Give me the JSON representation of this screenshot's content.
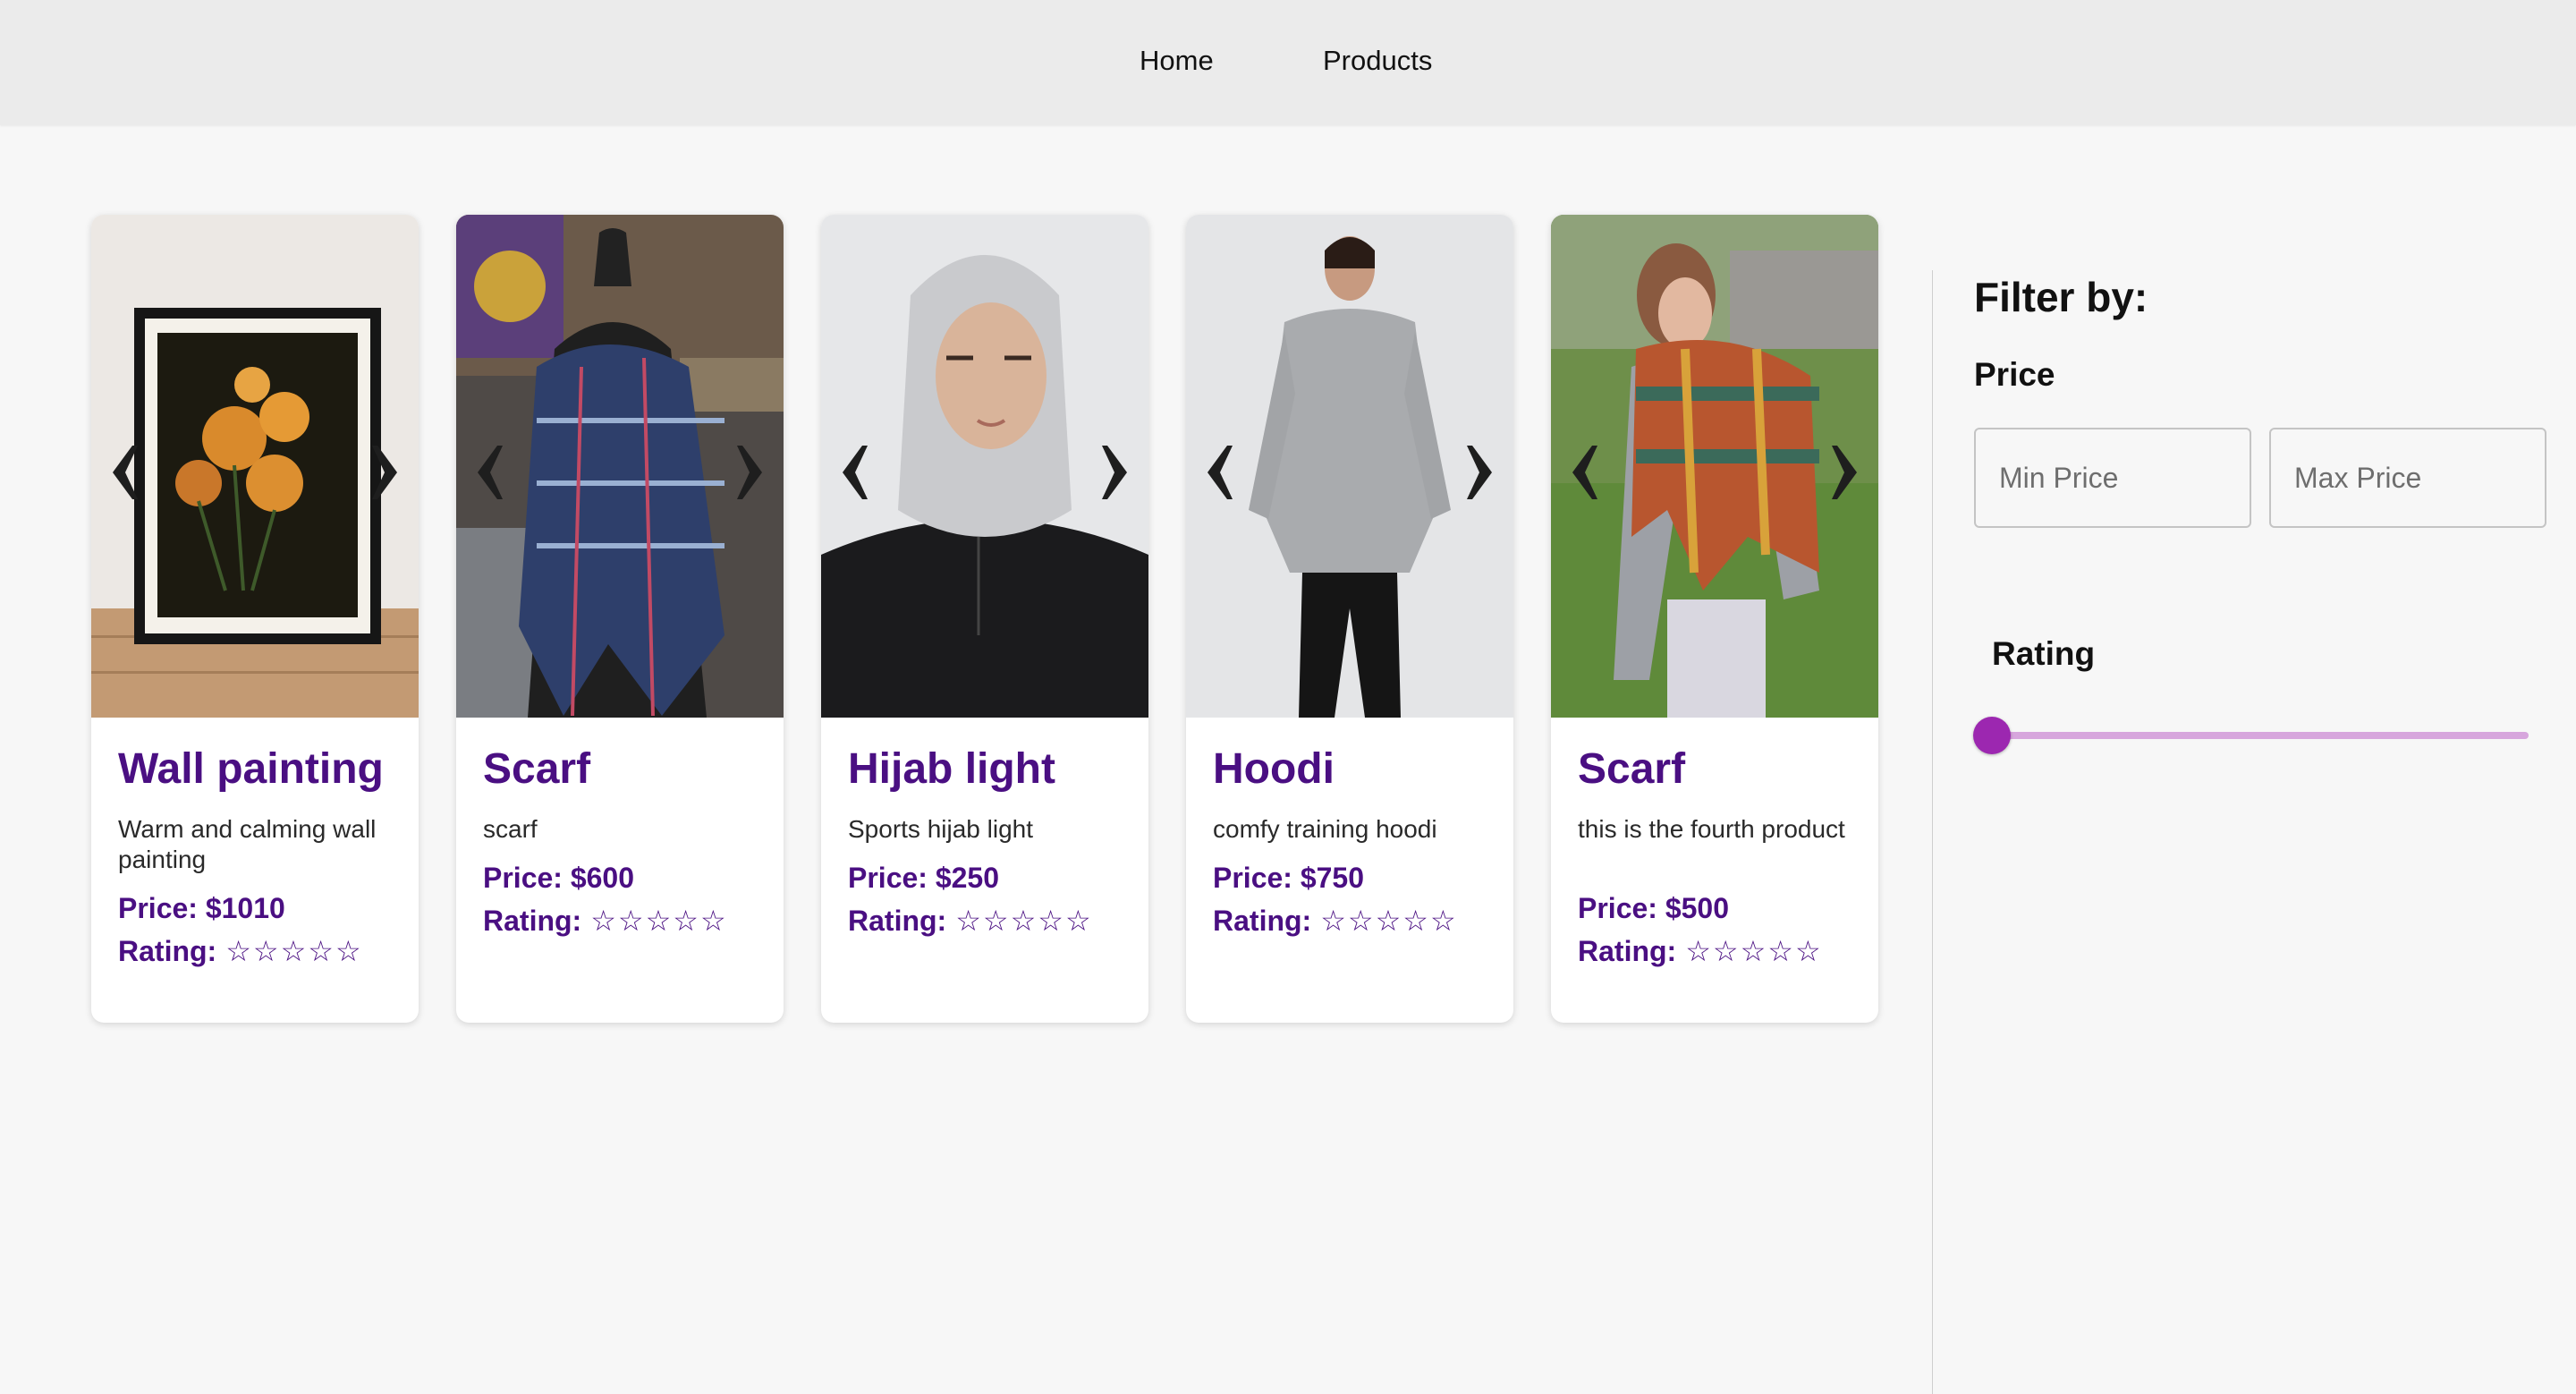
{
  "nav": {
    "home": "Home",
    "products": "Products"
  },
  "products": [
    {
      "title": "Wall painting",
      "description": "Warm and calming wall painting",
      "price": "Price: $1010",
      "rating_label": "Rating:",
      "stars": "☆☆☆☆☆"
    },
    {
      "title": "Scarf",
      "description": "scarf",
      "price": "Price: $600",
      "rating_label": "Rating:",
      "stars": "☆☆☆☆☆"
    },
    {
      "title": "Hijab light",
      "description": "Sports hijab light",
      "price": "Price: $250",
      "rating_label": "Rating:",
      "stars": "☆☆☆☆☆"
    },
    {
      "title": "Hoodi",
      "description": "comfy training hoodi",
      "price": "Price: $750",
      "rating_label": "Rating:",
      "stars": "☆☆☆☆☆"
    },
    {
      "title": "Scarf",
      "description": "this is the fourth product",
      "price": "Price: $500",
      "rating_label": "Rating:",
      "stars": "☆☆☆☆☆"
    }
  ],
  "filter": {
    "heading": "Filter by:",
    "price_heading": "Price",
    "min_placeholder": "Min Price",
    "max_placeholder": "Max Price",
    "rating_heading": "Rating",
    "rating_value": 0
  },
  "icons": {
    "carousel_prev": "chevron-left-icon",
    "carousel_next": "chevron-right-icon"
  },
  "colors": {
    "accent": "#4a0f82",
    "slider": "#9c27b0",
    "slider_track": "#d7a6dd",
    "nav_bg": "#ebebeb",
    "page_bg": "#f7f7f7"
  }
}
